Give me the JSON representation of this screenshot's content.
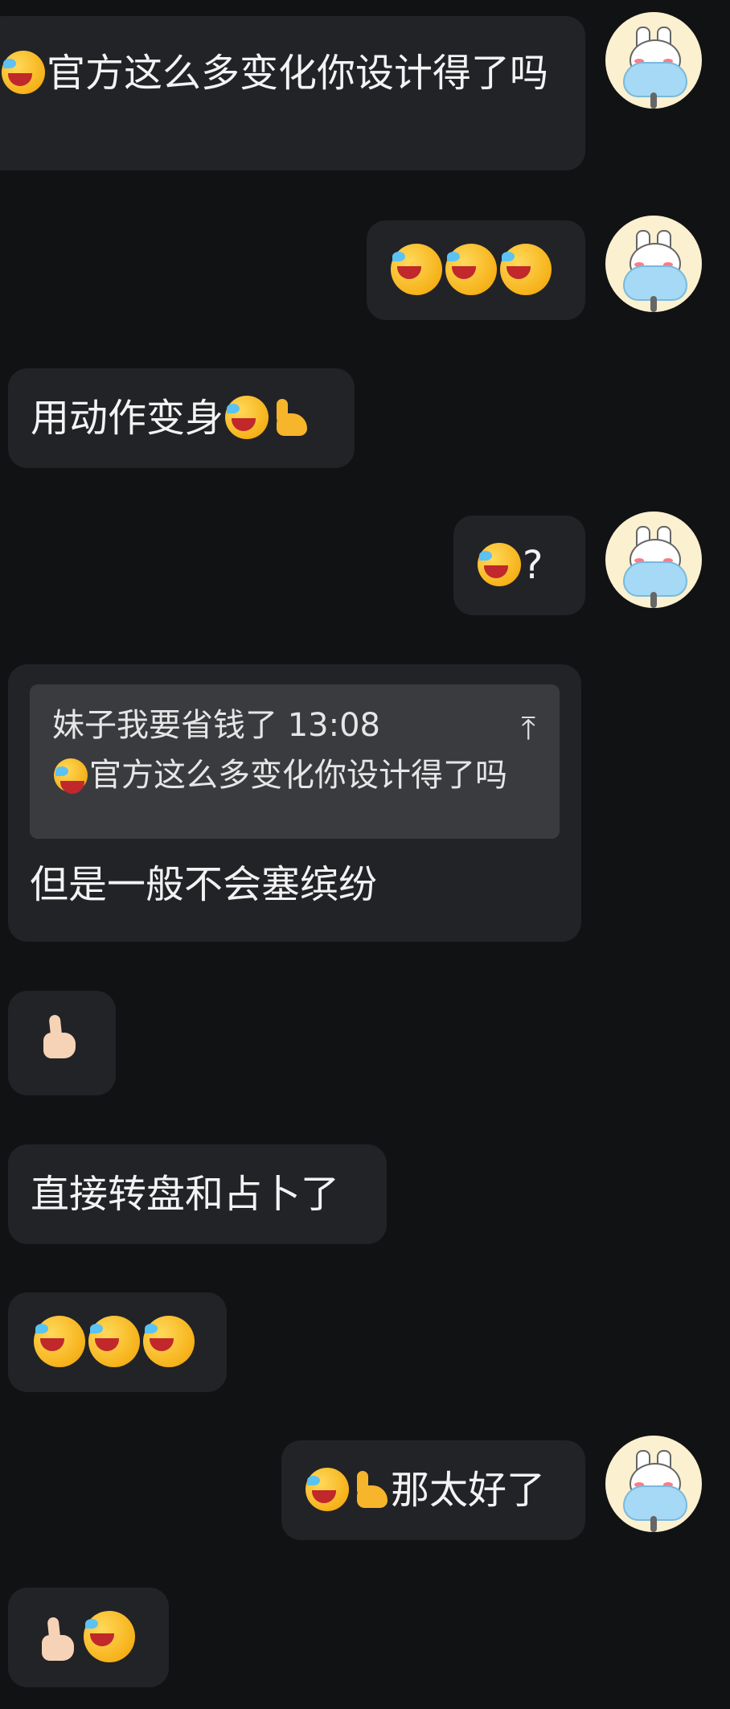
{
  "messages": [
    {
      "id": "m1",
      "side": "right",
      "text": "官方这么多变化你设计得了吗",
      "emoji_prefix": "cry-laugh"
    },
    {
      "id": "m2",
      "side": "right",
      "emojis": [
        "cry-laugh",
        "cry-laugh",
        "cry-laugh"
      ]
    },
    {
      "id": "m3",
      "side": "left",
      "text": "用动作变身",
      "emoji_suffix": [
        "cry-laugh",
        "muscle"
      ]
    },
    {
      "id": "m4",
      "side": "right",
      "text": "?",
      "emoji_prefix": "cry-laugh"
    },
    {
      "id": "m5",
      "side": "left",
      "quote": {
        "author": "妹子我要省钱了 13:08",
        "text": "官方这么多变化你设计得了吗",
        "icon": "jump-to-top-icon"
      },
      "text": "但是一般不会塞缤纷"
    },
    {
      "id": "m6",
      "side": "left",
      "emojis": [
        "thumbs-up"
      ]
    },
    {
      "id": "m7",
      "side": "left",
      "text": "直接转盘和占卜了"
    },
    {
      "id": "m8",
      "side": "left",
      "emojis": [
        "cry-laugh",
        "cry-laugh",
        "cry-laugh"
      ]
    },
    {
      "id": "m9",
      "side": "right",
      "text": "那太好了",
      "emoji_prefix": [
        "cry-laugh",
        "muscle"
      ]
    },
    {
      "id": "m10",
      "side": "left",
      "emojis": [
        "thumbs-up",
        "cry-laugh"
      ]
    }
  ],
  "ui": {
    "quote_icon_glyph": "⤒",
    "colors": {
      "background": "#111214",
      "bubble": "#222327",
      "quote": "#3a3b3f",
      "text": "#f3f3f3"
    }
  }
}
